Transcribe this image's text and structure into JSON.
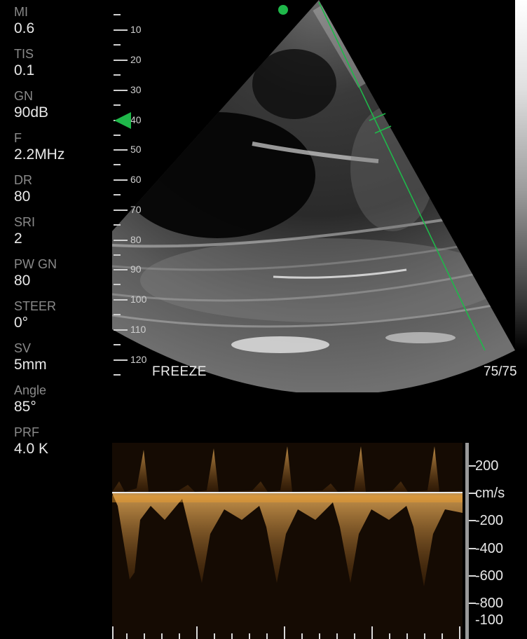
{
  "parameters": [
    {
      "label": "MI",
      "value": "0.6"
    },
    {
      "label": "TIS",
      "value": "0.1"
    },
    {
      "label": "GN",
      "value": "90dB"
    },
    {
      "label": "F",
      "value": "2.2MHz"
    },
    {
      "label": "DR",
      "value": "80"
    },
    {
      "label": "SRI",
      "value": "2"
    },
    {
      "label": "PW GN",
      "value": "80"
    },
    {
      "label": "STEER",
      "value": "0°"
    },
    {
      "label": "SV",
      "value": "5mm"
    },
    {
      "label": "Angle",
      "value": "85°"
    },
    {
      "label": "PRF",
      "value": "4.0 K"
    }
  ],
  "depth_scale": {
    "labels": [
      "10",
      "20",
      "30",
      "40",
      "50",
      "60",
      "70",
      "80",
      "90",
      "100",
      "110",
      "120"
    ],
    "focus_depth": 40
  },
  "status": {
    "freeze": "FREEZE",
    "frame_count": "75/75"
  },
  "doppler_scale": {
    "labels": [
      "200",
      "cm/s",
      "-200",
      "-400",
      "-600",
      "-800",
      "-100"
    ]
  },
  "colors": {
    "accent_green": "#1fb84a",
    "doppler_orange": "#f0a030"
  },
  "icons": {
    "focus_marker": "triangle-left-icon",
    "probe_orientation": "dot-icon"
  }
}
